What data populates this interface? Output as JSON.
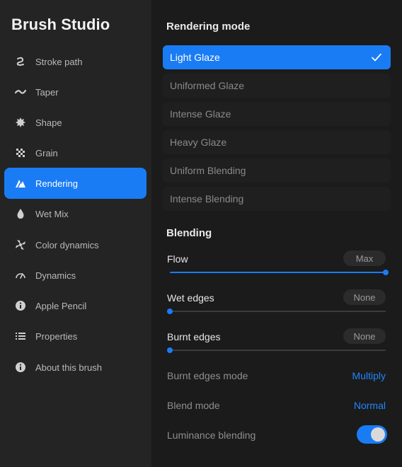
{
  "app_title": "Brush Studio",
  "sidebar": {
    "items": [
      {
        "label": "Stroke path",
        "icon": "stroke-path-icon"
      },
      {
        "label": "Taper",
        "icon": "taper-icon"
      },
      {
        "label": "Shape",
        "icon": "shape-icon"
      },
      {
        "label": "Grain",
        "icon": "grain-icon"
      },
      {
        "label": "Rendering",
        "icon": "rendering-icon",
        "active": true
      },
      {
        "label": "Wet Mix",
        "icon": "wet-mix-icon"
      },
      {
        "label": "Color dynamics",
        "icon": "color-dynamics-icon"
      },
      {
        "label": "Dynamics",
        "icon": "dynamics-icon"
      },
      {
        "label": "Apple Pencil",
        "icon": "apple-pencil-icon"
      },
      {
        "label": "Properties",
        "icon": "properties-icon"
      },
      {
        "label": "About this brush",
        "icon": "about-icon"
      }
    ]
  },
  "rendering": {
    "title": "Rendering mode",
    "modes": [
      "Light Glaze",
      "Uniformed Glaze",
      "Intense Glaze",
      "Heavy Glaze",
      "Uniform Blending",
      "Intense Blending"
    ],
    "selected": "Light Glaze"
  },
  "blending": {
    "title": "Blending",
    "sliders": [
      {
        "label": "Flow",
        "value_text": "Max",
        "level": 1.0
      },
      {
        "label": "Wet edges",
        "value_text": "None",
        "level": 0.0
      },
      {
        "label": "Burnt edges",
        "value_text": "None",
        "level": 0.0
      }
    ],
    "burnt_edges_mode": {
      "label": "Burnt edges mode",
      "value": "Multiply"
    },
    "blend_mode": {
      "label": "Blend mode",
      "value": "Normal"
    },
    "luminance_blending": {
      "label": "Luminance blending",
      "on": true
    }
  },
  "colors": {
    "accent": "#1a7cf5",
    "sidebar_bg": "#242424",
    "main_bg": "#1b1b1b"
  }
}
